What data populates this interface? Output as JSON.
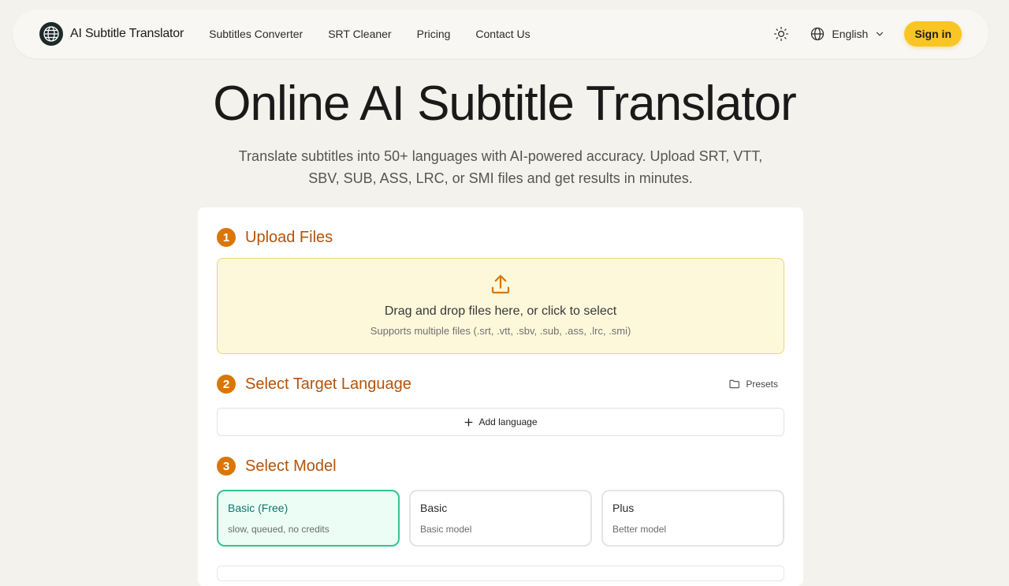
{
  "nav": {
    "brand": "AI Subtitle Translator",
    "links": [
      "Subtitles Converter",
      "SRT Cleaner",
      "Pricing",
      "Contact Us"
    ],
    "language": "English",
    "signin": "Sign in"
  },
  "hero": {
    "title": "Online AI Subtitle Translator",
    "subtitle": "Translate subtitles into 50+ languages with AI-powered accuracy. Upload SRT, VTT, SBV, SUB, ASS, LRC, or SMI files and get results in minutes."
  },
  "steps": {
    "upload": {
      "number": "1",
      "title": "Upload Files",
      "drop_title": "Drag and drop files here, or click to select",
      "drop_sub": "Supports multiple files (.srt, .vtt, .sbv, .sub, .ass, .lrc, .smi)"
    },
    "language": {
      "number": "2",
      "title": "Select Target Language",
      "presets": "Presets",
      "add_language": "Add language"
    },
    "model": {
      "number": "3",
      "title": "Select Model",
      "options": [
        {
          "name": "Basic (Free)",
          "desc": "slow, queued, no credits",
          "selected": true
        },
        {
          "name": "Basic",
          "desc": "Basic model",
          "selected": false
        },
        {
          "name": "Plus",
          "desc": "Better model",
          "selected": false
        }
      ]
    }
  },
  "colors": {
    "accent": "#d97706",
    "accent_text": "#b45309",
    "signin": "#f9c524",
    "selected": "#34c38f"
  },
  "icons": [
    "globe-logo-icon",
    "sun-icon",
    "globe-icon",
    "chevron-down-icon",
    "upload-icon",
    "folder-icon",
    "plus-icon"
  ]
}
